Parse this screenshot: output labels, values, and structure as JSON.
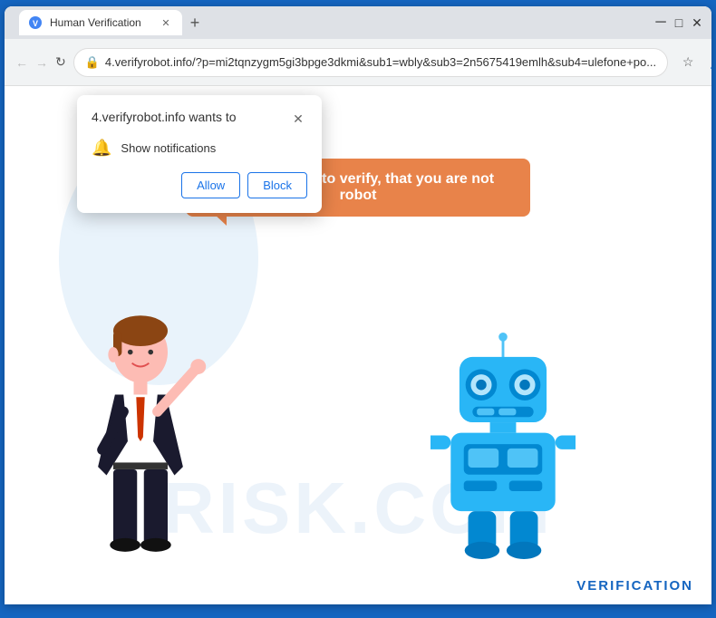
{
  "browser": {
    "title": "Human Verification",
    "tab_favicon": "🔒",
    "tab_title": "Human Verification",
    "url": "4.verifyrobot.info/?p=mi2tqnzygm5gi3bpge3dkmi&sub1=wbly&sub3=2n5675419emlh&sub4=ulefone+po...",
    "url_short": "4.verifyrobot.info",
    "url_full": "4.verifyrobot.info/?p=mi2tqnzygm5gi3bpge3dkmi&sub1=wbly&sub3=2n5675419emlh&sub4=ulefone+po...",
    "controls": {
      "minimize": "─",
      "maximize": "□",
      "close": "✕"
    },
    "nav": {
      "back": "←",
      "forward": "→",
      "refresh": "↻"
    }
  },
  "popup": {
    "title": "4.verifyrobot.info wants to",
    "close": "✕",
    "notification_icon": "🔔",
    "notification_text": "Show notifications",
    "allow_button": "Allow",
    "block_button": "Block"
  },
  "page": {
    "speech_bubble_text": "Press \"Allow\" to verify, that you are not robot",
    "watermark_text": "RISK.COM",
    "verification_label": "VERIFICATION",
    "bubble_arrow_color": "#E8834A",
    "accent_color": "#1565C0"
  }
}
